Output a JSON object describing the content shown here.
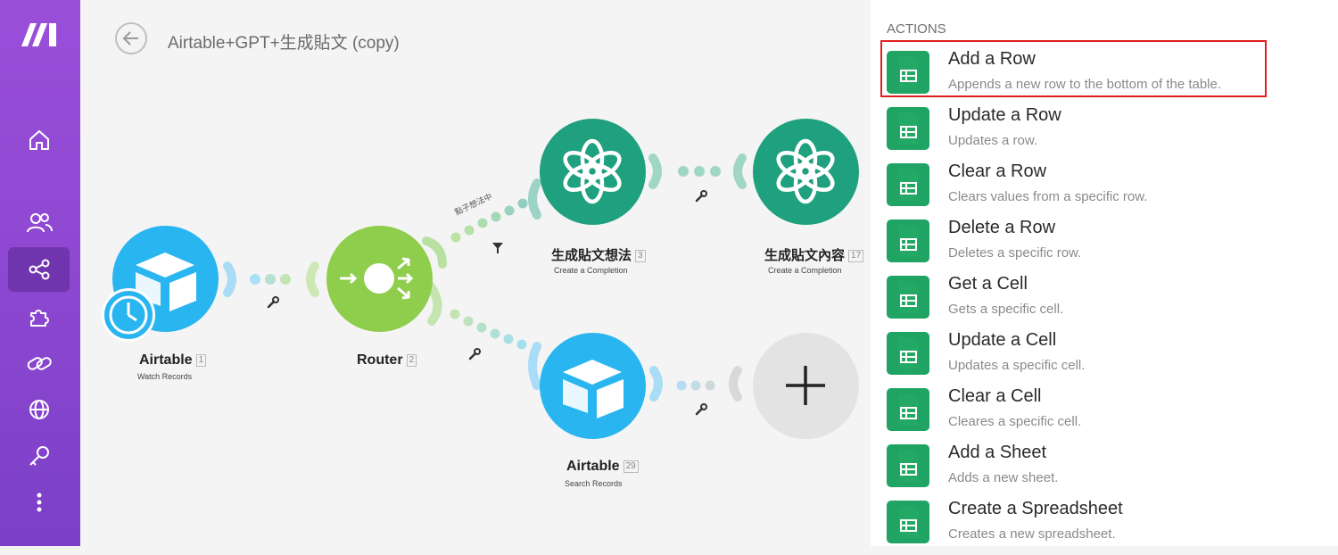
{
  "header": {
    "title": "Airtable+GPT+生成貼文 (copy)"
  },
  "sidebar": {
    "icons": [
      "make-logo-icon",
      "home-icon",
      "team-icon",
      "scenarios-icon",
      "templates-icon",
      "connections-icon",
      "webhooks-icon",
      "keys-icon",
      "more-icon"
    ]
  },
  "nodes": {
    "airtable1": {
      "name": "Airtable",
      "num": "1",
      "sub": "Watch Records"
    },
    "router": {
      "name": "Router",
      "num": "2"
    },
    "gpt1": {
      "name": "生成貼文想法",
      "num": "3",
      "sub": "Create a Completion"
    },
    "gpt2": {
      "name": "生成貼文內容",
      "num": "17",
      "sub": "Create a Completion"
    },
    "airtable2": {
      "name": "Airtable",
      "num": "29",
      "sub": "Search Records"
    }
  },
  "route_label": "點子想法中",
  "actions": {
    "heading": "ACTIONS",
    "items": [
      {
        "label": "Add a Row",
        "desc": "Appends a new row to the bottom of the table."
      },
      {
        "label": "Update a Row",
        "desc": "Updates a row."
      },
      {
        "label": "Clear a Row",
        "desc": "Clears values from a specific row."
      },
      {
        "label": "Delete a Row",
        "desc": "Deletes a specific row."
      },
      {
        "label": "Get a Cell",
        "desc": "Gets a specific cell."
      },
      {
        "label": "Update a Cell",
        "desc": "Updates a specific cell."
      },
      {
        "label": "Clear a Cell",
        "desc": "Cleares a specific cell."
      },
      {
        "label": "Add a Sheet",
        "desc": "Adds a new sheet."
      },
      {
        "label": "Create a Spreadsheet",
        "desc": "Creates a new spreadsheet."
      }
    ]
  },
  "colors": {
    "sidebar": "#8a46cf",
    "airtable": "#29b5f0",
    "router": "#8fcd4c",
    "openai": "#1fa07e",
    "sheets": "#1fa463",
    "highlight": "#e02020"
  }
}
